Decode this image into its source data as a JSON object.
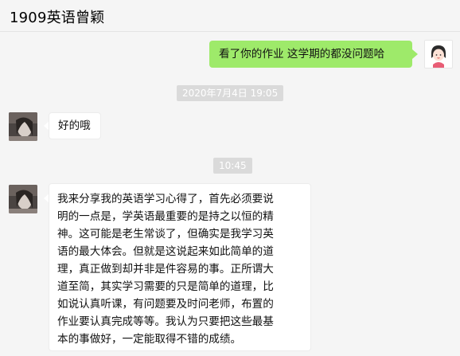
{
  "chat": {
    "title": "1909英语曾颖"
  },
  "messages": [
    {
      "id": "m1",
      "direction": "outgoing",
      "text": "看了你的作业 这学期的都没问题哈"
    },
    {
      "id": "t1",
      "type": "timestamp",
      "text": "2020年7月4日 19:05"
    },
    {
      "id": "m2",
      "direction": "incoming",
      "text": "好的哦"
    },
    {
      "id": "t2",
      "type": "timestamp",
      "text": "10:45"
    },
    {
      "id": "m3",
      "direction": "incoming",
      "lines": [
        "我来分享我的英语学习心得了，首先必须要说",
        "明的一点是，学英语最重要的是持之以恒的精",
        "神。这可能是老生常谈了，但确实是我学习英",
        "语的最大体会。但就是这说起来如此简单的道",
        "理，真正做到却并非是件容易的事。正所谓大",
        "道至简，其实学习需要的只是简单的道理，比",
        "如说认真听课，有问题要及时问老师，布置的",
        "作业要认真完成等等。我认为只要把这些最基",
        "本的事做好，一定能取得不错的成绩。"
      ]
    }
  ],
  "colors": {
    "outgoing_bubble": "#9eea6a",
    "incoming_bubble": "#ffffff",
    "timestamp_bg": "#dadada",
    "background": "#f5f5f5"
  },
  "icons": {
    "self_avatar": "cartoon-girl-avatar",
    "contact_avatar": "contact-photo-avatar"
  }
}
